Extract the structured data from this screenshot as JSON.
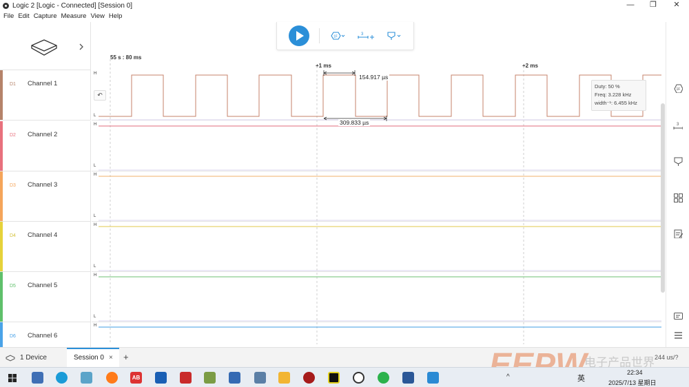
{
  "window": {
    "title": "Logic 2 [Logic - Connected] [Session 0]",
    "minimize": "—",
    "maximize": "❐",
    "close": "✕"
  },
  "menu": [
    "File",
    "Edit",
    "Capture",
    "Measure",
    "View",
    "Help"
  ],
  "ruler": {
    "start": "55 s : 80 ms",
    "mark1": "+1 ms",
    "mark2": "+2 ms"
  },
  "channels": [
    {
      "id": "D1",
      "name": "Channel 1",
      "color": "#b5836a"
    },
    {
      "id": "D2",
      "name": "Channel 2",
      "color": "#e8717d"
    },
    {
      "id": "D3",
      "name": "Channel 3",
      "color": "#f5a55a"
    },
    {
      "id": "D4",
      "name": "Channel 4",
      "color": "#e6d23a"
    },
    {
      "id": "D5",
      "name": "Channel 5",
      "color": "#5fc06b"
    },
    {
      "id": "D6",
      "name": "Channel 6",
      "color": "#4aa3e8"
    }
  ],
  "levels": {
    "high": "H",
    "low": "L"
  },
  "measurements": {
    "pulse_width": "154.917 µs",
    "period": "309.833 µs"
  },
  "tooltip": {
    "duty": "Duty: 50 %",
    "freq": "Freq: 3.228 kHz",
    "width": "width⁻¹: 6.455 kHz"
  },
  "bottom": {
    "device": "1 Device",
    "session_tab": "Session 0",
    "session_close": "×",
    "add_tab": "+",
    "status": "244 us/?"
  },
  "taskbar": {
    "time": "22:34",
    "date": "2025/7/13 星期日",
    "lang": "英",
    "caret": "^"
  },
  "watermark": "电子产品世界",
  "colors": {
    "accent": "#2b8fd8",
    "signal_d1": "#c4806a",
    "signal_d2": "#e16b7b",
    "signal_d4": "#e2c94b",
    "signal_d5": "#6cbf72",
    "signal_d6": "#3e9ce3"
  }
}
